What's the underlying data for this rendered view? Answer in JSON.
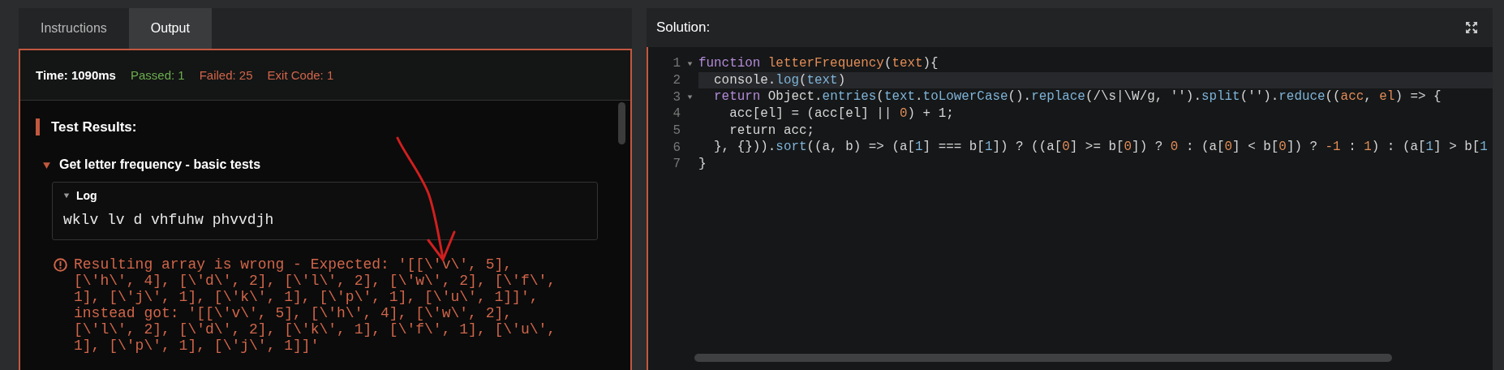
{
  "tabs": [
    {
      "label": "Instructions",
      "selected": false
    },
    {
      "label": "Output",
      "selected": true
    }
  ],
  "output": {
    "stats": [
      {
        "kind": "time",
        "text": "Time: 1090ms"
      },
      {
        "kind": "passed",
        "text": "Passed: 1"
      },
      {
        "kind": "failed",
        "text": "Failed: 25"
      },
      {
        "kind": "exit",
        "text": "Exit Code: 1"
      }
    ],
    "section_title": "Test Results:",
    "group": {
      "title": "Get letter frequency - basic tests",
      "expanded": true,
      "log": {
        "title": "Log",
        "expanded": true,
        "text": "wklv lv d vhfuhw phvvdjh"
      },
      "error": "Resulting array is wrong - Expected: '[[\\'v\\', 5], [\\'h\\', 4], [\\'d\\', 2], [\\'l\\', 2], [\\'w\\', 2], [\\'f\\', 1], [\\'j\\', 1], [\\'k\\', 1], [\\'p\\', 1], [\\'u\\', 1]]', instead got: '[[\\'v\\', 5], [\\'h\\', 4], [\\'w\\', 2], [\\'l\\', 2], [\\'d\\', 2], [\\'k\\', 1], [\\'f\\', 1], [\\'u\\', 1], [\\'p\\', 1], [\\'j\\', 1]]'"
    }
  },
  "solution": {
    "title": "Solution:",
    "lines": [
      {
        "number": "1",
        "foldable": true,
        "highlighted": false,
        "tokens": [
          {
            "text": "function ",
            "kind": "keyword"
          },
          {
            "text": "letterFrequency",
            "kind": "name"
          },
          {
            "text": "(",
            "kind": "plain"
          },
          {
            "text": "text",
            "kind": "name"
          },
          {
            "text": "){",
            "kind": "plain"
          }
        ]
      },
      {
        "number": "2",
        "foldable": false,
        "highlighted": true,
        "tokens": [
          {
            "text": "  console.",
            "kind": "plain"
          },
          {
            "text": "log",
            "kind": "method"
          },
          {
            "text": "(",
            "kind": "plain"
          },
          {
            "text": "text",
            "kind": "method"
          },
          {
            "text": ")",
            "kind": "plain"
          }
        ]
      },
      {
        "number": "3",
        "foldable": true,
        "highlighted": false,
        "tokens": [
          {
            "text": "  return",
            "kind": "keyword"
          },
          {
            "text": " Object.",
            "kind": "plain"
          },
          {
            "text": "entries",
            "kind": "method"
          },
          {
            "text": "(",
            "kind": "plain"
          },
          {
            "text": "text",
            "kind": "method"
          },
          {
            "text": ".",
            "kind": "plain"
          },
          {
            "text": "toLowerCase",
            "kind": "method"
          },
          {
            "text": "().",
            "kind": "plain"
          },
          {
            "text": "replace",
            "kind": "method"
          },
          {
            "text": "(/\\s|\\W/g, '').",
            "kind": "plain"
          },
          {
            "text": "split",
            "kind": "method"
          },
          {
            "text": "('').",
            "kind": "plain"
          },
          {
            "text": "reduce",
            "kind": "method"
          },
          {
            "text": "((",
            "kind": "plain"
          },
          {
            "text": "acc",
            "kind": "name"
          },
          {
            "text": ", ",
            "kind": "plain"
          },
          {
            "text": "el",
            "kind": "name"
          },
          {
            "text": ") => {",
            "kind": "plain"
          }
        ]
      },
      {
        "number": "4",
        "foldable": false,
        "highlighted": false,
        "tokens": [
          {
            "text": "    acc[el] = (acc[el] || ",
            "kind": "plain"
          },
          {
            "text": "0",
            "kind": "number"
          },
          {
            "text": ") + 1;",
            "kind": "plain"
          }
        ]
      },
      {
        "number": "5",
        "foldable": false,
        "highlighted": false,
        "tokens": [
          {
            "text": "    return acc;",
            "kind": "plain"
          }
        ]
      },
      {
        "number": "6",
        "foldable": false,
        "highlighted": false,
        "tokens": [
          {
            "text": "  }, {})).",
            "kind": "plain"
          },
          {
            "text": "sort",
            "kind": "method"
          },
          {
            "text": "((a, b) => (a[",
            "kind": "plain"
          },
          {
            "text": "1",
            "kind": "method"
          },
          {
            "text": "] === b[",
            "kind": "plain"
          },
          {
            "text": "1",
            "kind": "method"
          },
          {
            "text": "]) ? ((a[",
            "kind": "plain"
          },
          {
            "text": "0",
            "kind": "number"
          },
          {
            "text": "] >= b[",
            "kind": "plain"
          },
          {
            "text": "0",
            "kind": "number"
          },
          {
            "text": "]) ? ",
            "kind": "plain"
          },
          {
            "text": "0",
            "kind": "number"
          },
          {
            "text": " : (a[",
            "kind": "plain"
          },
          {
            "text": "0",
            "kind": "number"
          },
          {
            "text": "] < b[",
            "kind": "plain"
          },
          {
            "text": "0",
            "kind": "number"
          },
          {
            "text": "]) ? ",
            "kind": "plain"
          },
          {
            "text": "-1",
            "kind": "number"
          },
          {
            "text": " : ",
            "kind": "plain"
          },
          {
            "text": "1",
            "kind": "number"
          },
          {
            "text": ") : (a[",
            "kind": "plain"
          },
          {
            "text": "1",
            "kind": "method"
          },
          {
            "text": "] > b[",
            "kind": "plain"
          },
          {
            "text": "1",
            "kind": "method"
          }
        ]
      },
      {
        "number": "7",
        "foldable": false,
        "highlighted": false,
        "tokens": [
          {
            "text": "}",
            "kind": "plain"
          }
        ]
      }
    ]
  }
}
